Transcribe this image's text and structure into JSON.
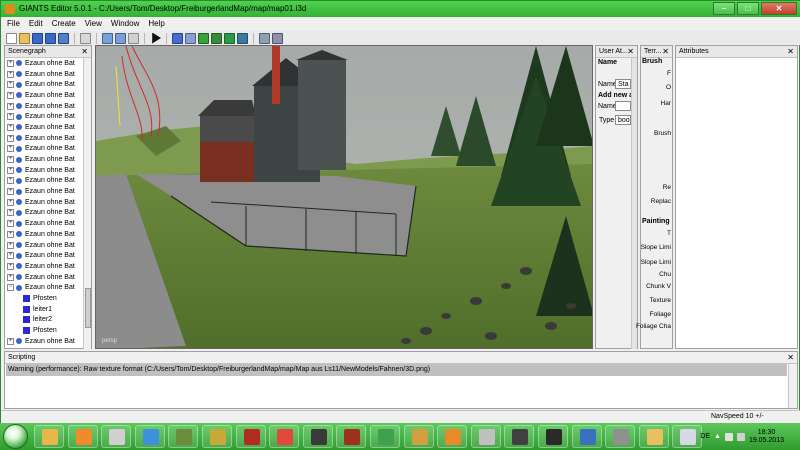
{
  "window": {
    "title": "GIANTS Editor 5.0.1 - C:/Users/Tom/Desktop/FreiburgerlandMap/map/map01.i3d"
  },
  "window_buttons": {
    "minimize": "–",
    "maximize": "□",
    "close": "✕"
  },
  "menu": [
    "File",
    "Edit",
    "Create",
    "View",
    "Window",
    "Help"
  ],
  "panels": {
    "scenegraph": {
      "title": "Scenegraph",
      "close": "✕",
      "items": [
        {
          "label": "Ezaun ohne Bat",
          "type": "node",
          "expand": "+"
        },
        {
          "label": "Ezaun ohne Bat",
          "type": "node",
          "expand": "+"
        },
        {
          "label": "Ezaun ohne Bat",
          "type": "node",
          "expand": "+"
        },
        {
          "label": "Ezaun ohne Bat",
          "type": "node",
          "expand": "+"
        },
        {
          "label": "Ezaun ohne Bat",
          "type": "node",
          "expand": "+"
        },
        {
          "label": "Ezaun ohne Bat",
          "type": "node",
          "expand": "+"
        },
        {
          "label": "Ezaun ohne Bat",
          "type": "node",
          "expand": "+"
        },
        {
          "label": "Ezaun ohne Bat",
          "type": "node",
          "expand": "+"
        },
        {
          "label": "Ezaun ohne Bat",
          "type": "node",
          "expand": "+"
        },
        {
          "label": "Ezaun ohne Bat",
          "type": "node",
          "expand": "+"
        },
        {
          "label": "Ezaun ohne Bat",
          "type": "node",
          "expand": "+"
        },
        {
          "label": "Ezaun ohne Bat",
          "type": "node",
          "expand": "+"
        },
        {
          "label": "Ezaun ohne Bat",
          "type": "node",
          "expand": "+"
        },
        {
          "label": "Ezaun ohne Bat",
          "type": "node",
          "expand": "+"
        },
        {
          "label": "Ezaun ohne Bat",
          "type": "node",
          "expand": "+"
        },
        {
          "label": "Ezaun ohne Bat",
          "type": "node",
          "expand": "+"
        },
        {
          "label": "Ezaun ohne Bat",
          "type": "node",
          "expand": "+"
        },
        {
          "label": "Ezaun ohne Bat",
          "type": "node",
          "expand": "+"
        },
        {
          "label": "Ezaun ohne Bat",
          "type": "node",
          "expand": "+"
        },
        {
          "label": "Ezaun ohne Bat",
          "type": "node",
          "expand": "+"
        },
        {
          "label": "Ezaun ohne Bat",
          "type": "node",
          "expand": "+"
        },
        {
          "label": "Ezaun ohne Bat",
          "type": "node",
          "expand": "−"
        },
        {
          "label": "Pfosten",
          "type": "shape"
        },
        {
          "label": "leiter1",
          "type": "shape"
        },
        {
          "label": "leiter2",
          "type": "shape"
        },
        {
          "label": "Pfosten",
          "type": "shape"
        },
        {
          "label": "Ezaun ohne Bat",
          "type": "node",
          "expand": "+"
        }
      ]
    },
    "viewport": {
      "camera_label": "persp"
    },
    "user_attributes": {
      "title": "User At...",
      "close": "✕",
      "section": "Name",
      "name_label": "Name",
      "name_value": "Sta",
      "add_new": "Add new a",
      "new_name_label": "Name",
      "type_label": "Type",
      "type_value": "bool"
    },
    "terrain": {
      "title": "Terr...",
      "close": "✕",
      "brush_header": "Brush",
      "labels": [
        "F",
        "O",
        "Har",
        "Brush",
        "Re",
        "Replac"
      ],
      "painting_header": "Painting",
      "painting_labels": [
        "T",
        "Slope Limi",
        "Slope Limi",
        "Chu",
        "Chunk V",
        "Texture",
        "Foliage",
        "Foliage Cha"
      ]
    },
    "attributes": {
      "title": "Attributes",
      "close": "✕"
    },
    "scripting": {
      "title": "Scripting",
      "close": "✕",
      "message": "Warning (performance): Raw texture format (C:/Users/Tom/Desktop/FreiburgerlandMap/map/Map aus Ls11/NewModels/Fahnen/3D.png)"
    }
  },
  "status": {
    "navspeed": "NavSpeed 10 +/-"
  },
  "taskbar": {
    "language": "DE",
    "time": "18:30",
    "date": "19.05.2013",
    "apps": [
      {
        "name": "explorer-icon",
        "color": "#e9b64a"
      },
      {
        "name": "media-player-icon",
        "color": "#f08a2a"
      },
      {
        "name": "tool-icon",
        "color": "#d0d0d0"
      },
      {
        "name": "internet-explorer-icon",
        "color": "#3d8fe0"
      },
      {
        "name": "minecraft-icon",
        "color": "#6b8c3a"
      },
      {
        "name": "game-icon",
        "color": "#c9a83a"
      },
      {
        "name": "farming-simulator-icon",
        "color": "#b22a20"
      },
      {
        "name": "chrome-icon",
        "color": "#e04a3a"
      },
      {
        "name": "tractor-icon",
        "color": "#3a3a3a"
      },
      {
        "name": "harvester-icon",
        "color": "#a03020"
      },
      {
        "name": "app-green-icon",
        "color": "#3fa050"
      },
      {
        "name": "photo-viewer-icon",
        "color": "#d0a040"
      },
      {
        "name": "blender-icon",
        "color": "#e88a2a"
      },
      {
        "name": "disc-icon",
        "color": "#c0c0c0"
      },
      {
        "name": "gamepad-icon",
        "color": "#404040"
      },
      {
        "name": "game2-icon",
        "color": "#2a2a2a"
      },
      {
        "name": "messenger-icon",
        "color": "#3a70c0"
      },
      {
        "name": "scanner-icon",
        "color": "#909090"
      },
      {
        "name": "folder-icon",
        "color": "#e8c060"
      },
      {
        "name": "editor-icon",
        "color": "#d8d8e8"
      }
    ]
  }
}
